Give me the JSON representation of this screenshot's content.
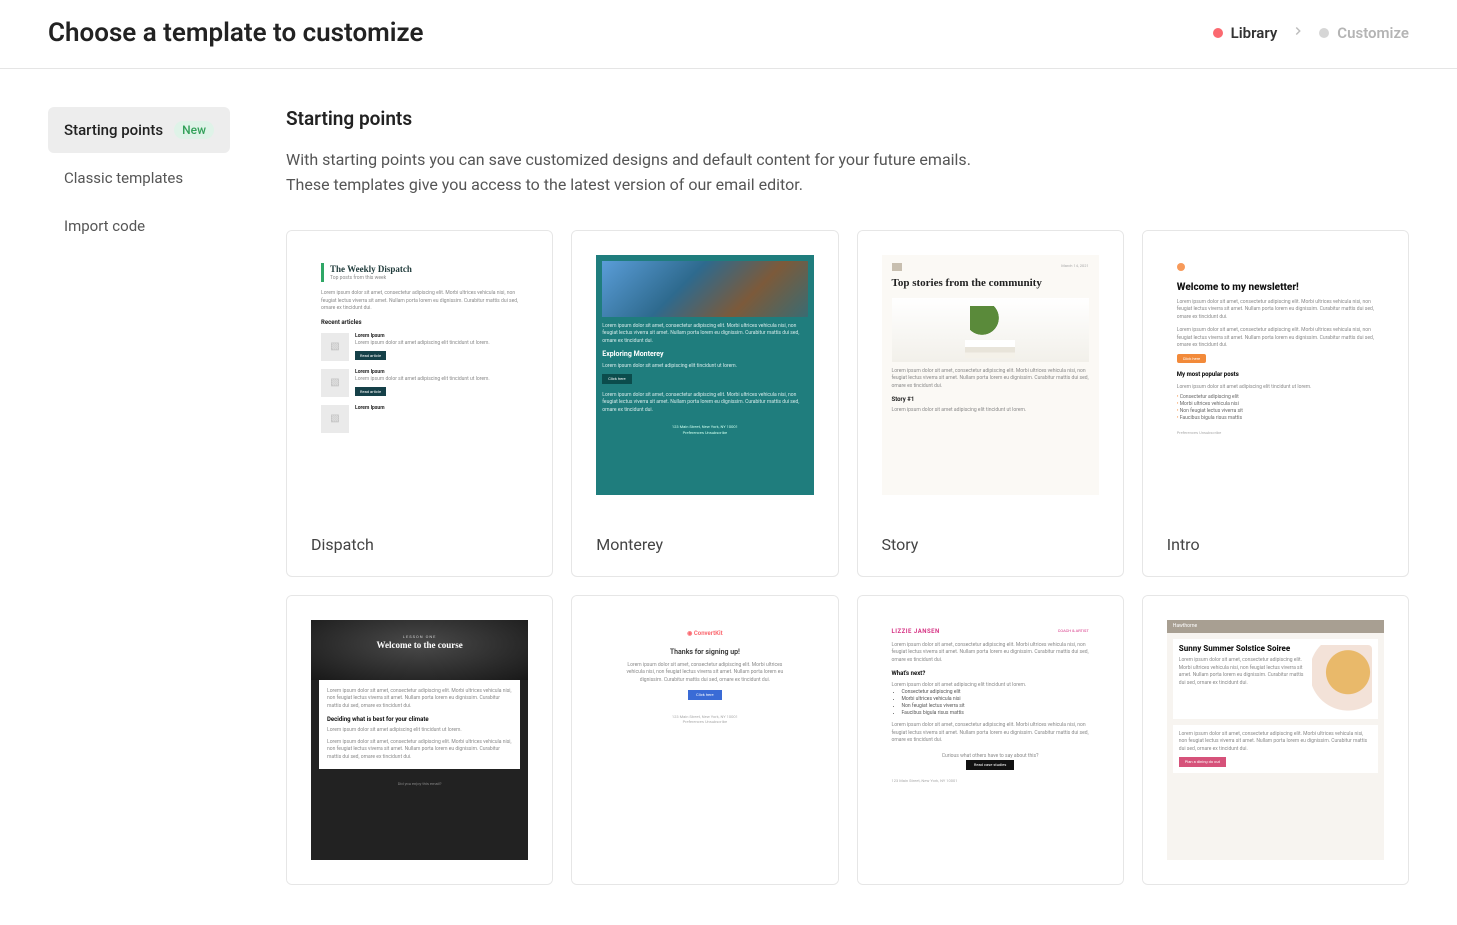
{
  "header": {
    "title": "Choose a template to customize",
    "steps": [
      {
        "label": "Library",
        "active": true
      },
      {
        "label": "Customize",
        "active": false
      }
    ]
  },
  "sidebar": {
    "items": [
      {
        "label": "Starting points",
        "badge": "New",
        "active": true
      },
      {
        "label": "Classic templates",
        "active": false
      },
      {
        "label": "Import code",
        "active": false
      }
    ]
  },
  "section": {
    "title": "Starting points",
    "description": "With starting points you can save customized designs and default content for your future emails.\nThese templates give you access to the latest version of our email editor."
  },
  "templates": [
    {
      "name": "Dispatch"
    },
    {
      "name": "Monterey"
    },
    {
      "name": "Story"
    },
    {
      "name": "Intro"
    },
    {
      "name": ""
    },
    {
      "name": ""
    },
    {
      "name": ""
    },
    {
      "name": ""
    }
  ],
  "preview_text": {
    "dispatch": {
      "title": "The Weekly Dispatch",
      "subtitle": "Top posts from this week",
      "section": "Recent articles",
      "item_title": "Lorem Ipsum",
      "button": "Read article"
    },
    "monterey": {
      "heading": "Exploring Monterey",
      "button": "Click here",
      "address": "123 Main Street, New York, NY 10001",
      "links": "Preferences   Unsubscribe"
    },
    "story": {
      "date": "March 14, 2021",
      "heading": "Top stories from the community",
      "item": "Story #1"
    },
    "intro": {
      "heading": "Welcome to my newsletter!",
      "button": "Click here",
      "section": "My most popular posts",
      "footer": "Preferences   Unsubscribe"
    },
    "course": {
      "pre": "LESSON ONE",
      "heading": "Welcome to the course",
      "section": "Deciding what is best for your climate",
      "question": "Did you enjoy this email?"
    },
    "ck": {
      "logo": "ConvertKit",
      "heading": "Thanks for signing up!",
      "button": "Click here",
      "address": "123 Main Street, New York, NY 10001",
      "links": "Preferences   Unsubscribe"
    },
    "lizzie": {
      "name": "LIZZIE JANSEN",
      "tag": "COACH & ARTIST",
      "section": "What's next?",
      "cta_intro": "Curious what others have to say about this?",
      "button": "Read case studies",
      "address": "123 Main Street, New York, NY 10001"
    },
    "hawthorne": {
      "bar": "Hawthorne",
      "heading": "Sunny Summer Solstice Soiree",
      "button": "Plan a dining do out"
    },
    "lorem_short": "Lorem ipsum dolor sit amet, consectetur adipiscing elit. Morbi ultrices vehicula nisi, non feugiat lectus viverra sit amet. Nullam porta lorem eu dignissim. Curabitur mattis dui sed, ornare ex tincidunt dui.",
    "lorem_tiny": "Lorem ipsum dolor sit amet adipiscing elit tincidunt ut lorem.",
    "bullets": [
      "Consectetur adipiscing elit",
      "Morbi ultrices vehicula nisi",
      "Non feugiat lectus viverra sit",
      "Faucibus bigula risus mattis"
    ]
  }
}
